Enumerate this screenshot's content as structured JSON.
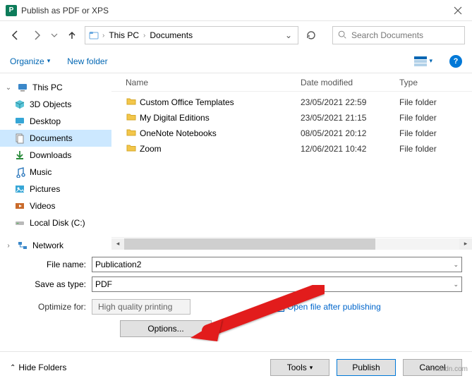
{
  "window": {
    "title": "Publish as PDF or XPS"
  },
  "breadcrumb": {
    "root": "This PC",
    "folder": "Documents"
  },
  "search": {
    "placeholder": "Search Documents"
  },
  "toolbar": {
    "organize": "Organize",
    "newfolder": "New folder"
  },
  "sidebar": {
    "items": [
      {
        "label": "This PC",
        "icon": "pc"
      },
      {
        "label": "3D Objects",
        "icon": "3d"
      },
      {
        "label": "Desktop",
        "icon": "desktop"
      },
      {
        "label": "Documents",
        "icon": "documents",
        "selected": true
      },
      {
        "label": "Downloads",
        "icon": "downloads"
      },
      {
        "label": "Music",
        "icon": "music"
      },
      {
        "label": "Pictures",
        "icon": "pictures"
      },
      {
        "label": "Videos",
        "icon": "videos"
      },
      {
        "label": "Local Disk (C:)",
        "icon": "disk"
      }
    ],
    "network": "Network"
  },
  "columns": {
    "name": "Name",
    "date": "Date modified",
    "type": "Type"
  },
  "files": [
    {
      "name": "Custom Office Templates",
      "date": "23/05/2021 22:59",
      "type": "File folder"
    },
    {
      "name": "My Digital Editions",
      "date": "23/05/2021 21:15",
      "type": "File folder"
    },
    {
      "name": "OneNote Notebooks",
      "date": "08/05/2021 20:12",
      "type": "File folder"
    },
    {
      "name": "Zoom",
      "date": "12/06/2021 10:42",
      "type": "File folder"
    }
  ],
  "fields": {
    "filename_label": "File name:",
    "filename_value": "Publication2",
    "saveas_label": "Save as type:",
    "saveas_value": "PDF",
    "optimize_label": "Optimize for:",
    "optimize_value": "High quality printing",
    "open_after": "Open file after publishing",
    "options_btn": "Options..."
  },
  "footer": {
    "hide": "Hide Folders",
    "tools": "Tools",
    "publish": "Publish",
    "cancel": "Cancel"
  },
  "watermark": "wsxdn.com"
}
